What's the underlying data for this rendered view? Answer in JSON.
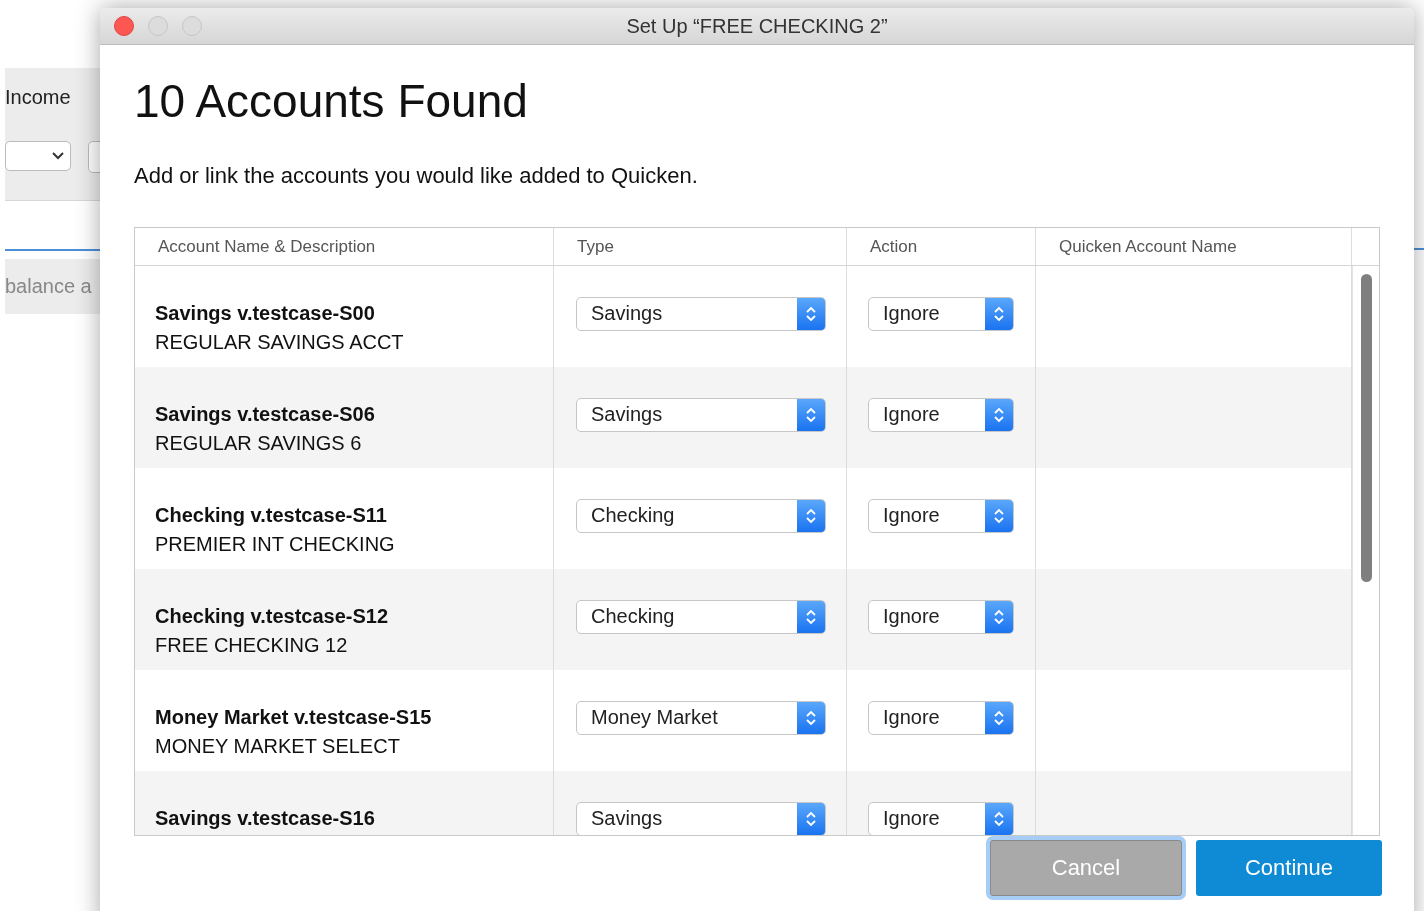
{
  "background_app": {
    "tab_label": "Income",
    "balance_label": "balance a"
  },
  "window": {
    "title": "Set Up “FREE CHECKING 2”"
  },
  "heading": "10 Accounts Found",
  "instruction": "Add or link the accounts you would like added to Quicken.",
  "table": {
    "columns": [
      "Account Name & Description",
      "Type",
      "Action",
      "Quicken Account Name"
    ],
    "rows": [
      {
        "name": "Savings v.testcase-S00",
        "description": "REGULAR SAVINGS ACCT",
        "type": "Savings",
        "action": "Ignore"
      },
      {
        "name": "Savings v.testcase-S06",
        "description": "REGULAR SAVINGS 6",
        "type": "Savings",
        "action": "Ignore"
      },
      {
        "name": "Checking v.testcase-S11",
        "description": "PREMIER INT CHECKING",
        "type": "Checking",
        "action": "Ignore"
      },
      {
        "name": "Checking v.testcase-S12",
        "description": "FREE CHECKING 12",
        "type": "Checking",
        "action": "Ignore"
      },
      {
        "name": "Money Market v.testcase-S15",
        "description": "MONEY MARKET SELECT",
        "type": "Money Market",
        "action": "Ignore"
      },
      {
        "name": "Savings v.testcase-S16",
        "type": "Savings",
        "action": "Ignore"
      }
    ]
  },
  "buttons": [
    {
      "label": "Cancel",
      "kind": "secondary",
      "focused": true
    },
    {
      "label": "Continue",
      "kind": "primary",
      "focused": false
    }
  ]
}
